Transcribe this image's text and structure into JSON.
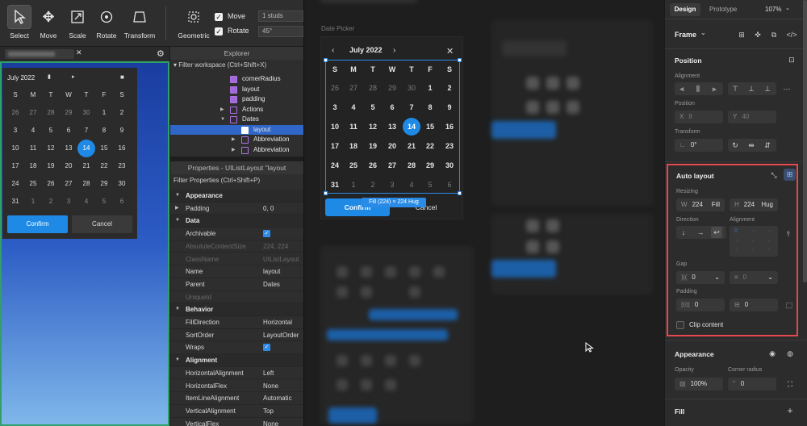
{
  "toolbar": {
    "tools": [
      {
        "label": "Select",
        "icon": "cursor-icon"
      },
      {
        "label": "Move",
        "icon": "move-icon"
      },
      {
        "label": "Scale",
        "icon": "scale-icon"
      },
      {
        "label": "Rotate",
        "icon": "rotate-icon"
      },
      {
        "label": "Transform",
        "icon": "transform-icon"
      }
    ],
    "geometric_label": "Geometric",
    "move_label": "Move",
    "move_value": "1 studs",
    "rotate_label": "Rotate",
    "rotate_value": "45°"
  },
  "roblox_picker": {
    "month": "July 2022",
    "weekdays": [
      "S",
      "M",
      "T",
      "W",
      "T",
      "F",
      "S"
    ],
    "days": [
      "26",
      "27",
      "28",
      "29",
      "30",
      "1",
      "2",
      "3",
      "4",
      "5",
      "6",
      "7",
      "8",
      "9",
      "10",
      "11",
      "12",
      "13",
      "14",
      "15",
      "16",
      "17",
      "18",
      "19",
      "20",
      "21",
      "22",
      "23",
      "24",
      "25",
      "26",
      "27",
      "28",
      "29",
      "30",
      "31",
      "1",
      "2",
      "3",
      "4",
      "5",
      "6"
    ],
    "confirm": "Confirm",
    "cancel": "Cancel"
  },
  "explorer": {
    "title": "Explorer",
    "filter": "Filter workspace (Ctrl+Shift+X)",
    "items": [
      "cornerRadius",
      "layout",
      "padding",
      "Actions",
      "Dates",
      "layout",
      "Abbreviation",
      "Abbreviation"
    ]
  },
  "properties": {
    "title": "Properties - UIListLayout \"layout",
    "filter": "Filter Properties (Ctrl+Shift+P)",
    "rows": [
      {
        "k": "Appearance",
        "v": "",
        "cat": true
      },
      {
        "k": "Padding",
        "v": "0, 0"
      },
      {
        "k": "Data",
        "v": "",
        "cat": true
      },
      {
        "k": "Archivable",
        "v": "",
        "check": true
      },
      {
        "k": "AbsoluteContentSize",
        "v": "224, 224",
        "dis": true
      },
      {
        "k": "ClassName",
        "v": "UIListLayout",
        "dis": true
      },
      {
        "k": "Name",
        "v": "layout"
      },
      {
        "k": "Parent",
        "v": "Dates"
      },
      {
        "k": "UniqueId",
        "v": "",
        "dis": true
      },
      {
        "k": "Behavior",
        "v": "",
        "cat": true
      },
      {
        "k": "FillDirection",
        "v": "Horizontal"
      },
      {
        "k": "SortOrder",
        "v": "LayoutOrder"
      },
      {
        "k": "Wraps",
        "v": "",
        "check": true
      },
      {
        "k": "Alignment",
        "v": "",
        "cat": true
      },
      {
        "k": "HorizontalAlignment",
        "v": "Left"
      },
      {
        "k": "HorizontalFlex",
        "v": "None"
      },
      {
        "k": "ItemLineAlignment",
        "v": "Automatic"
      },
      {
        "k": "VerticalAlignment",
        "v": "Top"
      },
      {
        "k": "VerticalFlex",
        "v": "None"
      }
    ]
  },
  "figma_picker": {
    "frame_label": "Date Picker",
    "month": "July 2022",
    "weekdays": [
      "S",
      "M",
      "T",
      "W",
      "T",
      "F",
      "S"
    ],
    "days": [
      "26",
      "27",
      "28",
      "29",
      "30",
      "1",
      "2",
      "3",
      "4",
      "5",
      "6",
      "7",
      "8",
      "9",
      "10",
      "11",
      "12",
      "13",
      "14",
      "15",
      "16",
      "17",
      "18",
      "19",
      "20",
      "21",
      "22",
      "23",
      "24",
      "25",
      "26",
      "27",
      "28",
      "29",
      "30",
      "31",
      "1",
      "2",
      "3",
      "4",
      "5",
      "6"
    ],
    "confirm": "Confirm",
    "cancel": "Cancel",
    "size_badge": "Fill (224) × 224 Hug"
  },
  "panel": {
    "tab_design": "Design",
    "tab_prototype": "Prototype",
    "zoom": "107%",
    "frame": "Frame",
    "position_title": "Position",
    "alignment_label": "Alignment",
    "position_label": "Position",
    "x_prefix": "X",
    "x_value": "8",
    "y_prefix": "Y",
    "y_value": "40",
    "transform_label": "Transform",
    "rotation": "0°",
    "autolayout_title": "Auto layout",
    "resizing_label": "Resizing",
    "w_prefix": "W",
    "w_value": "224",
    "w_mode": "Fill",
    "h_prefix": "H",
    "h_value": "224",
    "h_mode": "Hug",
    "direction_label": "Direction",
    "alignment2_label": "Alignment",
    "gap_label": "Gap",
    "gap_value": "0",
    "gap2_value": "0",
    "padding_label": "Padding",
    "pad_h": "0",
    "pad_v": "0",
    "clip_label": "Clip content",
    "appearance_title": "Appearance",
    "opacity_label": "Opacity",
    "opacity_value": "100%",
    "radius_label": "Corner radius",
    "radius_value": "0",
    "fill_title": "Fill"
  },
  "colors": {
    "accent": "#1f8ae6",
    "highlight": "#e5484d"
  }
}
